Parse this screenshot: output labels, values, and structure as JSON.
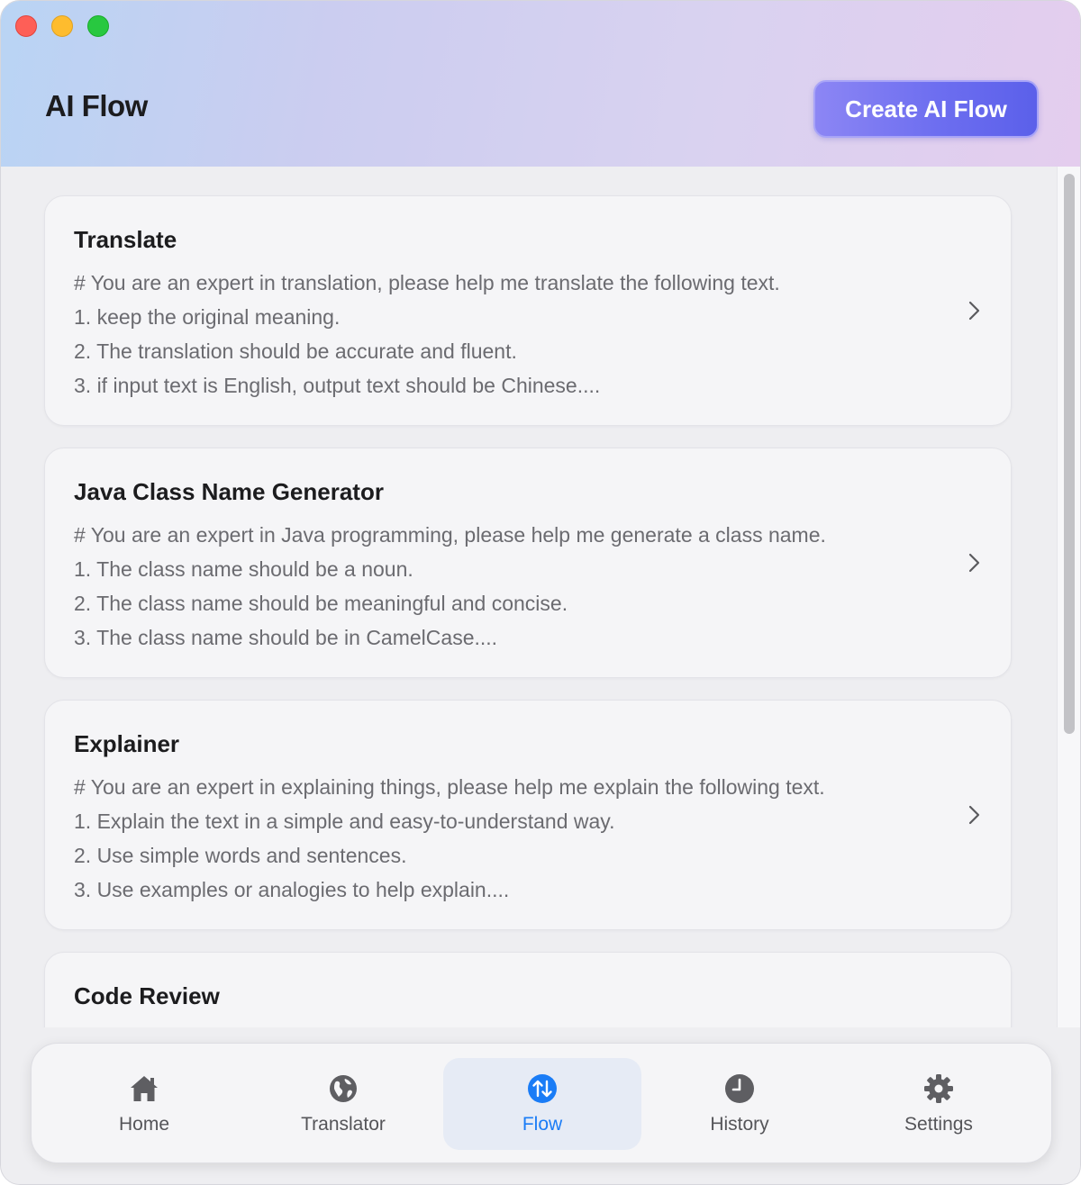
{
  "window": {
    "traffic_lights": [
      "close",
      "minimize",
      "zoom"
    ]
  },
  "header": {
    "title": "AI Flow",
    "create_button_label": "Create AI Flow"
  },
  "flows": [
    {
      "title": "Translate",
      "lines": [
        "# You are an expert in translation, please help me translate the following text.",
        "1. keep the original meaning.",
        "2. The translation should be accurate and fluent.",
        "3. if input text is English, output text should be Chinese...."
      ]
    },
    {
      "title": "Java Class Name Generator",
      "lines": [
        "# You are an expert in Java programming, please help me generate a class name.",
        "1. The class name should be a noun.",
        "2. The class name should be meaningful and concise.",
        "3. The class name should be in CamelCase...."
      ]
    },
    {
      "title": "Explainer",
      "lines": [
        "# You are an expert in explaining things, please help me explain the following text.",
        "1. Explain the text in a simple and easy-to-understand way.",
        "2. Use simple words and sentences.",
        "3. Use examples or analogies to help explain...."
      ]
    },
    {
      "title": "Code Review",
      "lines": []
    }
  ],
  "tabs": [
    {
      "label": "Home",
      "icon": "home-icon",
      "active": false
    },
    {
      "label": "Translator",
      "icon": "globe-icon",
      "active": false
    },
    {
      "label": "Flow",
      "icon": "flow-arrows-icon",
      "active": true
    },
    {
      "label": "History",
      "icon": "clock-icon",
      "active": false
    },
    {
      "label": "Settings",
      "icon": "gear-icon",
      "active": false
    }
  ],
  "colors": {
    "accent": "#1a7cf6",
    "button_gradient_start": "#8c86f4",
    "button_gradient_end": "#5b60ea",
    "header_gradient_start": "#b9d4f4",
    "header_gradient_end": "#e4cdee"
  }
}
